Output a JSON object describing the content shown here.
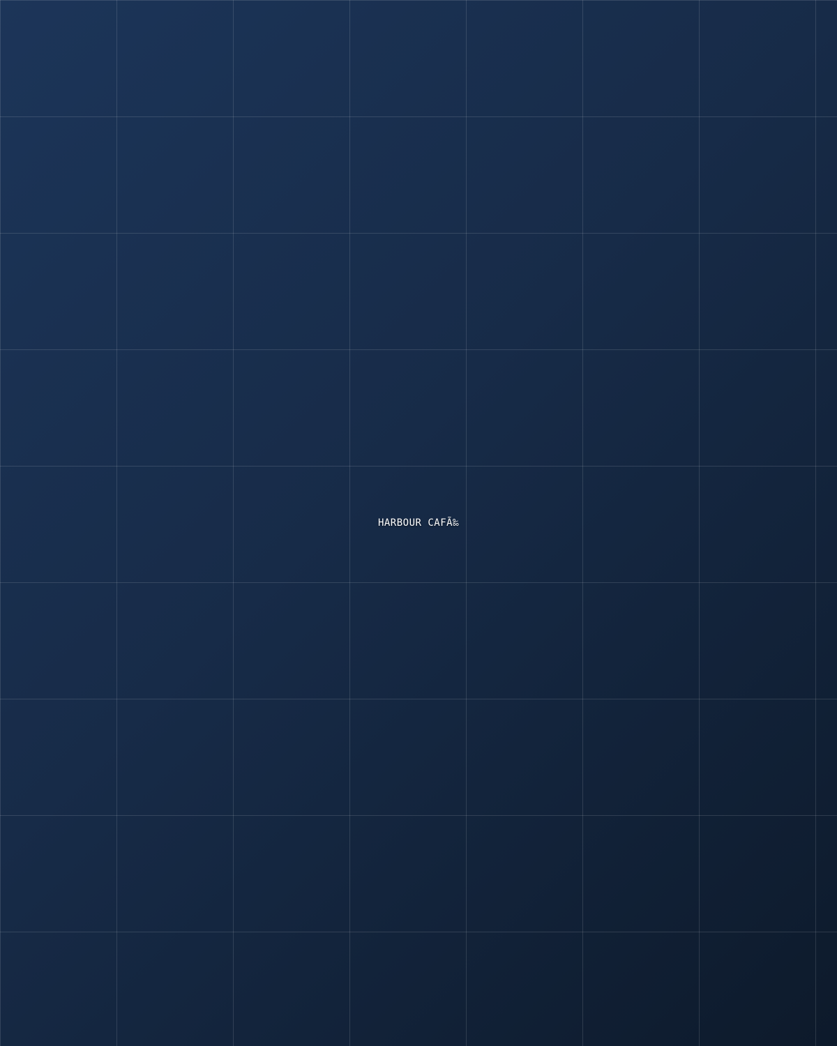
{
  "sign": {
    "title": "HARBOUR CAFÃ‰"
  },
  "colors": {
    "background_top_left": "#1c3559",
    "background_bottom_right": "#0d1a2b",
    "grid_line": "rgba(255,255,255,0.13)",
    "text": "#ffffff"
  }
}
